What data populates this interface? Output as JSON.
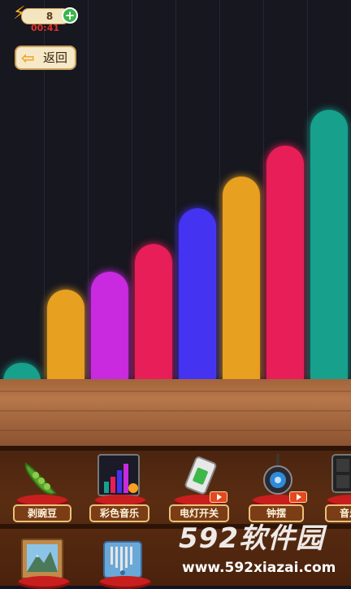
{
  "hud": {
    "energy_icon": "lightning-icon",
    "energy_count": "8",
    "add_icon": "plus-icon",
    "timer": "00:41"
  },
  "back_button": {
    "icon": "arrow-left-icon",
    "label": "返回"
  },
  "bars": [
    {
      "color": "#17a08c",
      "level": 0.05
    },
    {
      "color": "#e8a020",
      "level": 0.26
    },
    {
      "color": "#c92ae0",
      "level": 0.31
    },
    {
      "color": "#e81e58",
      "level": 0.39
    },
    {
      "color": "#4433f0",
      "level": 0.49
    },
    {
      "color": "#e8a020",
      "level": 0.58
    },
    {
      "color": "#e81e58",
      "level": 0.67
    },
    {
      "color": "#17a08c",
      "level": 0.77
    }
  ],
  "shelf_items": [
    {
      "label": "剥豌豆",
      "icon": "pea-pod-icon",
      "video": false
    },
    {
      "label": "彩色音乐",
      "icon": "color-music-icon",
      "video": false
    },
    {
      "label": "电灯开关",
      "icon": "light-switch-icon",
      "video": true
    },
    {
      "label": "钟摆",
      "icon": "pendulum-icon",
      "video": true
    },
    {
      "label": "音乐",
      "icon": "music-pad-icon",
      "video": false
    }
  ],
  "lower_items": [
    {
      "icon": "landscape-frame-icon"
    },
    {
      "icon": "kalimba-icon"
    }
  ],
  "watermark": {
    "brand": "592软件园",
    "url": "www.592xiazai.com"
  }
}
